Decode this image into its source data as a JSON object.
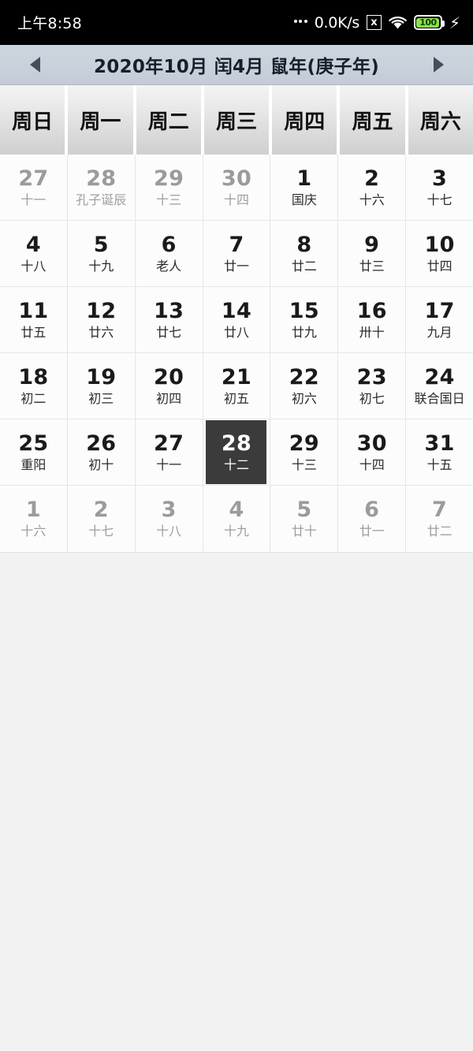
{
  "statusbar": {
    "time": "上午8:58",
    "network_speed": "0.0K/s",
    "xbox_icon_label": "x",
    "battery_level": "100",
    "charging_icon": "⚡",
    "icons": [
      "dots-icon",
      "network-speed",
      "x-box-icon",
      "wifi-icon",
      "battery-icon",
      "charging-bolt-icon"
    ]
  },
  "titlebar": {
    "prev_label": "◀",
    "next_label": "▶",
    "title": "2020年10月 闰4月 鼠年(庚子年)"
  },
  "weekdays": [
    "周日",
    "周一",
    "周二",
    "周三",
    "周四",
    "周五",
    "周六"
  ],
  "weeks": [
    [
      {
        "num": "27",
        "lunar": "十一",
        "other": true,
        "selected": false
      },
      {
        "num": "28",
        "lunar": "孔子诞辰",
        "other": true,
        "selected": false
      },
      {
        "num": "29",
        "lunar": "十三",
        "other": true,
        "selected": false
      },
      {
        "num": "30",
        "lunar": "十四",
        "other": true,
        "selected": false
      },
      {
        "num": "1",
        "lunar": "国庆",
        "other": false,
        "selected": false
      },
      {
        "num": "2",
        "lunar": "十六",
        "other": false,
        "selected": false
      },
      {
        "num": "3",
        "lunar": "十七",
        "other": false,
        "selected": false
      }
    ],
    [
      {
        "num": "4",
        "lunar": "十八",
        "other": false,
        "selected": false
      },
      {
        "num": "5",
        "lunar": "十九",
        "other": false,
        "selected": false
      },
      {
        "num": "6",
        "lunar": "老人",
        "other": false,
        "selected": false
      },
      {
        "num": "7",
        "lunar": "廿一",
        "other": false,
        "selected": false
      },
      {
        "num": "8",
        "lunar": "廿二",
        "other": false,
        "selected": false
      },
      {
        "num": "9",
        "lunar": "廿三",
        "other": false,
        "selected": false
      },
      {
        "num": "10",
        "lunar": "廿四",
        "other": false,
        "selected": false
      }
    ],
    [
      {
        "num": "11",
        "lunar": "廿五",
        "other": false,
        "selected": false
      },
      {
        "num": "12",
        "lunar": "廿六",
        "other": false,
        "selected": false
      },
      {
        "num": "13",
        "lunar": "廿七",
        "other": false,
        "selected": false
      },
      {
        "num": "14",
        "lunar": "廿八",
        "other": false,
        "selected": false
      },
      {
        "num": "15",
        "lunar": "廿九",
        "other": false,
        "selected": false
      },
      {
        "num": "16",
        "lunar": "卅十",
        "other": false,
        "selected": false
      },
      {
        "num": "17",
        "lunar": "九月",
        "other": false,
        "selected": false
      }
    ],
    [
      {
        "num": "18",
        "lunar": "初二",
        "other": false,
        "selected": false
      },
      {
        "num": "19",
        "lunar": "初三",
        "other": false,
        "selected": false
      },
      {
        "num": "20",
        "lunar": "初四",
        "other": false,
        "selected": false
      },
      {
        "num": "21",
        "lunar": "初五",
        "other": false,
        "selected": false
      },
      {
        "num": "22",
        "lunar": "初六",
        "other": false,
        "selected": false
      },
      {
        "num": "23",
        "lunar": "初七",
        "other": false,
        "selected": false
      },
      {
        "num": "24",
        "lunar": "联合国日",
        "other": false,
        "selected": false
      }
    ],
    [
      {
        "num": "25",
        "lunar": "重阳",
        "other": false,
        "selected": false
      },
      {
        "num": "26",
        "lunar": "初十",
        "other": false,
        "selected": false
      },
      {
        "num": "27",
        "lunar": "十一",
        "other": false,
        "selected": false
      },
      {
        "num": "28",
        "lunar": "十二",
        "other": false,
        "selected": true
      },
      {
        "num": "29",
        "lunar": "十三",
        "other": false,
        "selected": false
      },
      {
        "num": "30",
        "lunar": "十四",
        "other": false,
        "selected": false
      },
      {
        "num": "31",
        "lunar": "十五",
        "other": false,
        "selected": false
      }
    ],
    [
      {
        "num": "1",
        "lunar": "十六",
        "other": true,
        "selected": false
      },
      {
        "num": "2",
        "lunar": "十七",
        "other": true,
        "selected": false
      },
      {
        "num": "3",
        "lunar": "十八",
        "other": true,
        "selected": false
      },
      {
        "num": "4",
        "lunar": "十九",
        "other": true,
        "selected": false
      },
      {
        "num": "5",
        "lunar": "廿十",
        "other": true,
        "selected": false
      },
      {
        "num": "6",
        "lunar": "廿一",
        "other": true,
        "selected": false
      },
      {
        "num": "7",
        "lunar": "廿二",
        "other": true,
        "selected": false
      }
    ]
  ],
  "colors": {
    "statusbar_bg": "#000000",
    "titlebar_bg": "#ccd5de",
    "weekday_bg": "#e6e6e6",
    "cell_bg": "#fcfcfc",
    "selected_bg": "#3b3b3b",
    "page_bg": "#f2f2f2",
    "battery_green": "#8ce04a"
  }
}
